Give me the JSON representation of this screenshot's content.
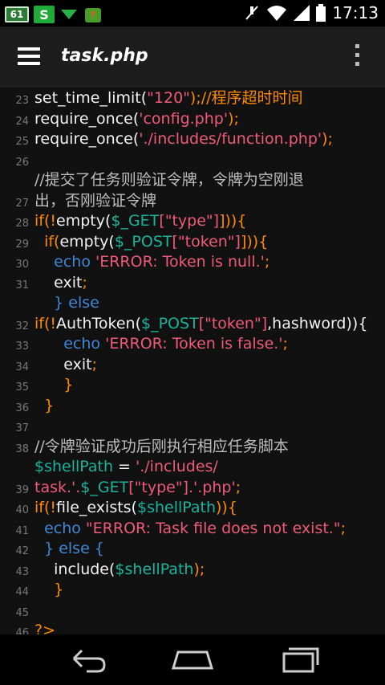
{
  "statusbar": {
    "badge_61": "61",
    "badge_s": "S",
    "time": "17:13",
    "icons": [
      "61-badge-icon",
      "s-app-icon",
      "download-icon",
      "android-app-icon",
      "mute-icon",
      "wifi-icon",
      "signal-icon",
      "battery-icon"
    ]
  },
  "appbar": {
    "title": "task.php"
  },
  "editor": {
    "lines": [
      {
        "n": "23",
        "rows": [
          [
            [
              "set_time_limit(",
              "w"
            ],
            [
              "\"120\"",
              "r"
            ],
            [
              ");//程序超时时间",
              "o"
            ]
          ]
        ]
      },
      {
        "n": "24",
        "rows": [
          [
            [
              "require_once(",
              "w"
            ],
            [
              "'config.php'",
              "r"
            ],
            [
              ");",
              "o"
            ]
          ]
        ]
      },
      {
        "n": "25",
        "rows": [
          [
            [
              "require_once(",
              "w"
            ],
            [
              "'./includes/function.php'",
              "r"
            ],
            [
              ");",
              "o"
            ]
          ]
        ]
      },
      {
        "n": "26",
        "rows": [
          [
            [
              "",
              ""
            ]
          ]
        ]
      },
      {
        "n": "27",
        "rows": [
          [
            [
              "//提交了任务则验证令牌，令牌为空刚退",
              "g"
            ]
          ],
          [
            [
              "出，否刚验证令牌",
              "g"
            ]
          ]
        ]
      },
      {
        "n": "28",
        "rows": [
          [
            [
              "if(!",
              "o"
            ],
            [
              "empty(",
              "w"
            ],
            [
              "$_GET",
              "t"
            ],
            [
              "[\"type\"]",
              "r"
            ],
            [
              "])){",
              "o"
            ]
          ]
        ]
      },
      {
        "n": "29",
        "rows": [
          [
            [
              "  if(",
              "o"
            ],
            [
              "empty(",
              "w"
            ],
            [
              "$_POST",
              "t"
            ],
            [
              "[\"token\"]",
              "r"
            ],
            [
              "])){",
              "o"
            ]
          ]
        ]
      },
      {
        "n": "30",
        "rows": [
          [
            [
              "    echo ",
              "b"
            ],
            [
              "'ERROR: Token is null.'",
              "r"
            ],
            [
              ";",
              "o"
            ]
          ]
        ]
      },
      {
        "n": "31",
        "rows": [
          [
            [
              "    exit",
              "w"
            ],
            [
              ";",
              "o"
            ]
          ]
        ]
      },
      {
        "n": "32",
        "rows": [
          [
            [
              "    } else",
              "b"
            ]
          ],
          [
            [
              "if(!",
              "o"
            ],
            [
              "AuthToken(",
              "w"
            ],
            [
              "$_POST",
              "t"
            ],
            [
              "[\"token\"]",
              "r"
            ],
            [
              ",hashword)){",
              "w"
            ]
          ]
        ]
      },
      {
        "n": "33",
        "rows": [
          [
            [
              "      echo ",
              "b"
            ],
            [
              "'ERROR: Token is false.'",
              "r"
            ],
            [
              ";",
              "o"
            ]
          ]
        ]
      },
      {
        "n": "34",
        "rows": [
          [
            [
              "      exit",
              "w"
            ],
            [
              ";",
              "o"
            ]
          ]
        ]
      },
      {
        "n": "35",
        "rows": [
          [
            [
              "      }",
              "o"
            ]
          ]
        ]
      },
      {
        "n": "36",
        "rows": [
          [
            [
              "  }",
              "o"
            ]
          ]
        ]
      },
      {
        "n": "37",
        "rows": [
          [
            [
              "",
              ""
            ]
          ]
        ]
      },
      {
        "n": "38",
        "rows": [
          [
            [
              "//令牌验证成功后刚执行相应任务脚本",
              "g"
            ]
          ]
        ]
      },
      {
        "n": "39",
        "rows": [
          [
            [
              "$shellPath",
              "t"
            ],
            [
              " = ",
              "w"
            ],
            [
              "'./includes/",
              "r"
            ]
          ],
          [
            [
              "task.'.",
              "r"
            ],
            [
              "$_GET",
              "t"
            ],
            [
              "[\"type\"]",
              "r"
            ],
            [
              ".'.php'",
              "r"
            ],
            [
              ";",
              "o"
            ]
          ]
        ]
      },
      {
        "n": "40",
        "rows": [
          [
            [
              "if(!",
              "o"
            ],
            [
              "file_exists(",
              "w"
            ],
            [
              "$shellPath",
              "t"
            ],
            [
              ")){",
              "o"
            ]
          ]
        ]
      },
      {
        "n": "41",
        "rows": [
          [
            [
              "  echo ",
              "b"
            ],
            [
              "\"ERROR: Task file does not exist.\"",
              "r"
            ],
            [
              ";",
              "o"
            ]
          ]
        ]
      },
      {
        "n": "42",
        "rows": [
          [
            [
              "  } else {",
              "b"
            ]
          ]
        ]
      },
      {
        "n": "43",
        "rows": [
          [
            [
              "    include(",
              "w"
            ],
            [
              "$shellPath",
              "t"
            ],
            [
              ");",
              "o"
            ]
          ]
        ]
      },
      {
        "n": "44",
        "rows": [
          [
            [
              "    }",
              "o"
            ]
          ]
        ]
      },
      {
        "n": "45",
        "rows": [
          [
            [
              "",
              ""
            ]
          ]
        ]
      },
      {
        "n": "46",
        "rows": [
          [
            [
              "?>",
              "o"
            ]
          ]
        ]
      }
    ]
  },
  "colors": {
    "w": "#f2f2f2",
    "o": "#ff8a00",
    "r": "#ef5a78",
    "t": "#19b49c",
    "g": "#bdbdbd",
    "b": "#3f86d6"
  },
  "navbar": {
    "icons": [
      "back-icon",
      "home-icon",
      "recent-apps-icon"
    ]
  }
}
